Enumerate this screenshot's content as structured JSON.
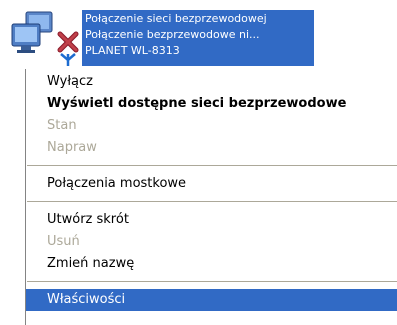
{
  "connection": {
    "lines": [
      "Połączenie sieci bezprzewodowej",
      "Połączenie bezprzewodowe ni...",
      "PLANET WL-8313"
    ]
  },
  "icons": {
    "connection": "wireless-network-connection-icon",
    "status": "disconnected-red-x-icon"
  },
  "menu": {
    "items": [
      {
        "label": "Wyłącz",
        "state": "enabled"
      },
      {
        "label": "Wyświetl dostępne sieci bezprzewodowe",
        "state": "default-bold"
      },
      {
        "label": "Stan",
        "state": "disabled"
      },
      {
        "label": "Napraw",
        "state": "disabled"
      },
      {
        "label": "Połączenia mostkowe",
        "state": "enabled"
      },
      {
        "label": "Utwórz skrót",
        "state": "enabled"
      },
      {
        "label": "Usuń",
        "state": "disabled"
      },
      {
        "label": "Zmień nazwę",
        "state": "enabled"
      },
      {
        "label": "Właściwości",
        "state": "highlighted"
      }
    ]
  },
  "colors": {
    "selection": "#316ac5",
    "disabled_text": "#aca899",
    "status_x": "#c0404a"
  }
}
